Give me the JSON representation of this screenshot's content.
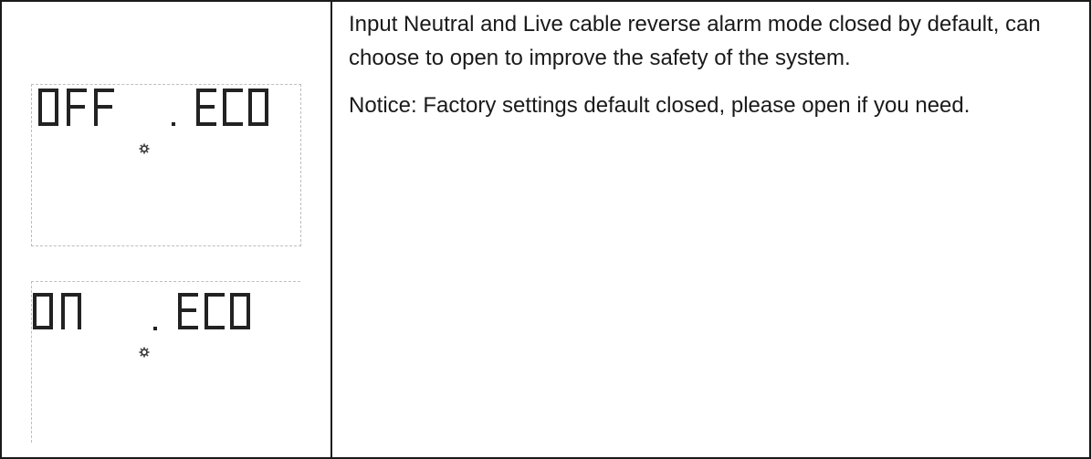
{
  "lcd_screens": [
    {
      "left_word": "OFF",
      "right_word": "ECO",
      "indicator": "gear-dot"
    },
    {
      "left_word": "ON",
      "right_word": "ECO",
      "indicator": "gear-dot"
    }
  ],
  "description": {
    "paragraph_1": "Input Neutral and Live cable reverse alarm mode closed by default, can choose to open to improve the safety of the system.",
    "paragraph_2": "Notice: Factory settings default closed, please open if you need."
  }
}
